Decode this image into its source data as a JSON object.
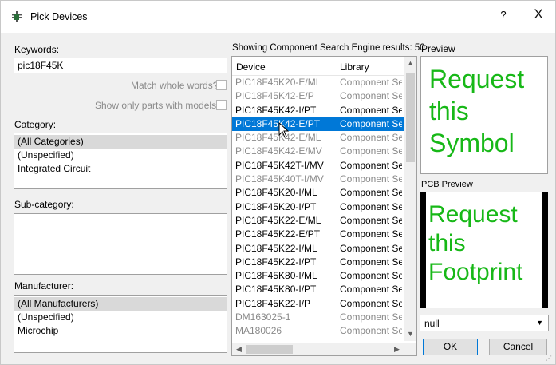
{
  "window": {
    "title": "Pick Devices",
    "help_label": "?",
    "close_label": "X"
  },
  "keywords": {
    "label": "Keywords:",
    "value": "pic18F45K",
    "match_whole_words": "Match whole words?",
    "show_only_models": "Show only parts with models?"
  },
  "category": {
    "label": "Category:",
    "items": [
      "(All Categories)",
      "(Unspecified)",
      "Integrated Circuit"
    ]
  },
  "subcategory": {
    "label": "Sub-category:"
  },
  "manufacturer": {
    "label": "Manufacturer:",
    "items": [
      "(All Manufacturers)",
      "(Unspecified)",
      "Microchip"
    ]
  },
  "results": {
    "caption": "Showing Component Search Engine results: 50",
    "col_device": "Device",
    "col_library": "Library",
    "rows": [
      {
        "device": "PIC18F45K20-E/ML",
        "library": "Component Search Engine",
        "dim": true
      },
      {
        "device": "PIC18F45K42-E/P",
        "library": "Component Search Engine",
        "dim": true
      },
      {
        "device": "PIC18F45K42-I/PT",
        "library": "Component Search Engine",
        "dim": false
      },
      {
        "device": "PIC18F45K42-E/PT",
        "library": "Component Search Engine",
        "dim": false,
        "selected": true
      },
      {
        "device": "PIC18F45K42-E/ML",
        "library": "Component Search Engine",
        "dim": true
      },
      {
        "device": "PIC18F45K42-E/MV",
        "library": "Component Search Engine",
        "dim": true
      },
      {
        "device": "PIC18F45K42T-I/MV",
        "library": "Component Search Engine",
        "dim": false
      },
      {
        "device": "PIC18F45K40T-I/MV",
        "library": "Component Search Engine",
        "dim": true
      },
      {
        "device": "PIC18F45K20-I/ML",
        "library": "Component Search Engine",
        "dim": false
      },
      {
        "device": "PIC18F45K20-I/PT",
        "library": "Component Search Engine",
        "dim": false
      },
      {
        "device": "PIC18F45K22-E/ML",
        "library": "Component Search Engine",
        "dim": false
      },
      {
        "device": "PIC18F45K22-E/PT",
        "library": "Component Search Engine",
        "dim": false
      },
      {
        "device": "PIC18F45K22-I/ML",
        "library": "Component Search Engine",
        "dim": false
      },
      {
        "device": "PIC18F45K22-I/PT",
        "library": "Component Search Engine",
        "dim": false
      },
      {
        "device": "PIC18F45K80-I/ML",
        "library": "Component Search Engine",
        "dim": false
      },
      {
        "device": "PIC18F45K80-I/PT",
        "library": "Component Search Engine",
        "dim": false
      },
      {
        "device": "PIC18F45K22-I/P",
        "library": "Component Search Engine",
        "dim": false
      },
      {
        "device": "DM163025-1",
        "library": "Component Search Engine",
        "dim": true
      },
      {
        "device": "MA180026",
        "library": "Component Search Engine",
        "dim": true
      }
    ]
  },
  "preview": {
    "label": "Preview",
    "text": "Request this Symbol"
  },
  "pcb_preview": {
    "label": "PCB Preview",
    "text": "Request this Footprint"
  },
  "footprint_select": {
    "value": "null"
  },
  "buttons": {
    "ok": "OK",
    "cancel": "Cancel"
  },
  "colors": {
    "accent": "#0078d7",
    "request_text": "#17b817"
  }
}
